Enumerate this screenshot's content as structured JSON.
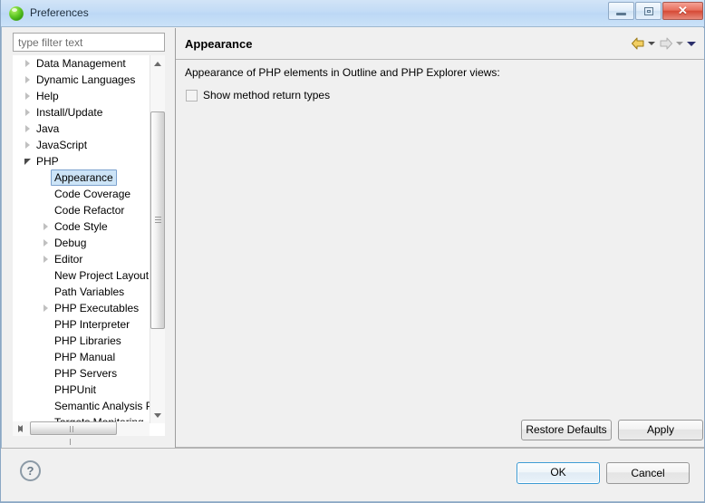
{
  "window": {
    "title": "Preferences",
    "icon": "green-sphere-icon",
    "controls": {
      "minimize": "minimize-icon",
      "restore": "restore-icon",
      "close": "✕"
    }
  },
  "filter": {
    "placeholder": "type filter text",
    "value": ""
  },
  "tree": {
    "items": [
      {
        "label": "Data Management",
        "indent": 0,
        "twisty": "collapsed",
        "selected": false
      },
      {
        "label": "Dynamic Languages",
        "indent": 0,
        "twisty": "collapsed",
        "selected": false
      },
      {
        "label": "Help",
        "indent": 0,
        "twisty": "collapsed",
        "selected": false
      },
      {
        "label": "Install/Update",
        "indent": 0,
        "twisty": "collapsed",
        "selected": false
      },
      {
        "label": "Java",
        "indent": 0,
        "twisty": "collapsed",
        "selected": false
      },
      {
        "label": "JavaScript",
        "indent": 0,
        "twisty": "collapsed",
        "selected": false
      },
      {
        "label": "PHP",
        "indent": 0,
        "twisty": "expanded",
        "selected": false
      },
      {
        "label": "Appearance",
        "indent": 1,
        "twisty": "none",
        "selected": true
      },
      {
        "label": "Code Coverage",
        "indent": 1,
        "twisty": "none",
        "selected": false
      },
      {
        "label": "Code Refactor",
        "indent": 1,
        "twisty": "none",
        "selected": false
      },
      {
        "label": "Code Style",
        "indent": 1,
        "twisty": "collapsed",
        "selected": false
      },
      {
        "label": "Debug",
        "indent": 1,
        "twisty": "collapsed",
        "selected": false
      },
      {
        "label": "Editor",
        "indent": 1,
        "twisty": "collapsed",
        "selected": false
      },
      {
        "label": "New Project Layout",
        "indent": 1,
        "twisty": "none",
        "selected": false
      },
      {
        "label": "Path Variables",
        "indent": 1,
        "twisty": "none",
        "selected": false
      },
      {
        "label": "PHP Executables",
        "indent": 1,
        "twisty": "collapsed",
        "selected": false
      },
      {
        "label": "PHP Interpreter",
        "indent": 1,
        "twisty": "none",
        "selected": false
      },
      {
        "label": "PHP Libraries",
        "indent": 1,
        "twisty": "none",
        "selected": false
      },
      {
        "label": "PHP Manual",
        "indent": 1,
        "twisty": "none",
        "selected": false
      },
      {
        "label": "PHP Servers",
        "indent": 1,
        "twisty": "none",
        "selected": false
      },
      {
        "label": "PHPUnit",
        "indent": 1,
        "twisty": "none",
        "selected": false
      },
      {
        "label": "Semantic Analysis P",
        "indent": 1,
        "twisty": "none",
        "selected": false
      },
      {
        "label": "Targets Monitoring",
        "indent": 1,
        "twisty": "none",
        "selected": false
      }
    ]
  },
  "page": {
    "title": "Appearance",
    "description": "Appearance of PHP elements in Outline and PHP Explorer views:",
    "checkbox": {
      "label": "Show method return types",
      "checked": false
    },
    "nav": {
      "back_icon": "back-arrow-icon",
      "back_menu_icon": "chevron-down-icon",
      "forward_icon": "forward-arrow-icon",
      "forward_menu_icon": "chevron-down-icon",
      "menu_icon": "chevron-down-icon"
    },
    "restore_defaults_label": "Restore Defaults",
    "apply_label": "Apply"
  },
  "footer": {
    "help_icon": "?",
    "ok_label": "OK",
    "cancel_label": "Cancel"
  },
  "colors": {
    "titlebar": "#bcd8f5",
    "selection": "#cce4f7",
    "selection_border": "#7da2ce",
    "back_arrow": "#e8c24a",
    "forward_arrow": "#cfcfcf",
    "close_button": "#d54a36",
    "ok_focus_border": "#3c9bd4"
  }
}
